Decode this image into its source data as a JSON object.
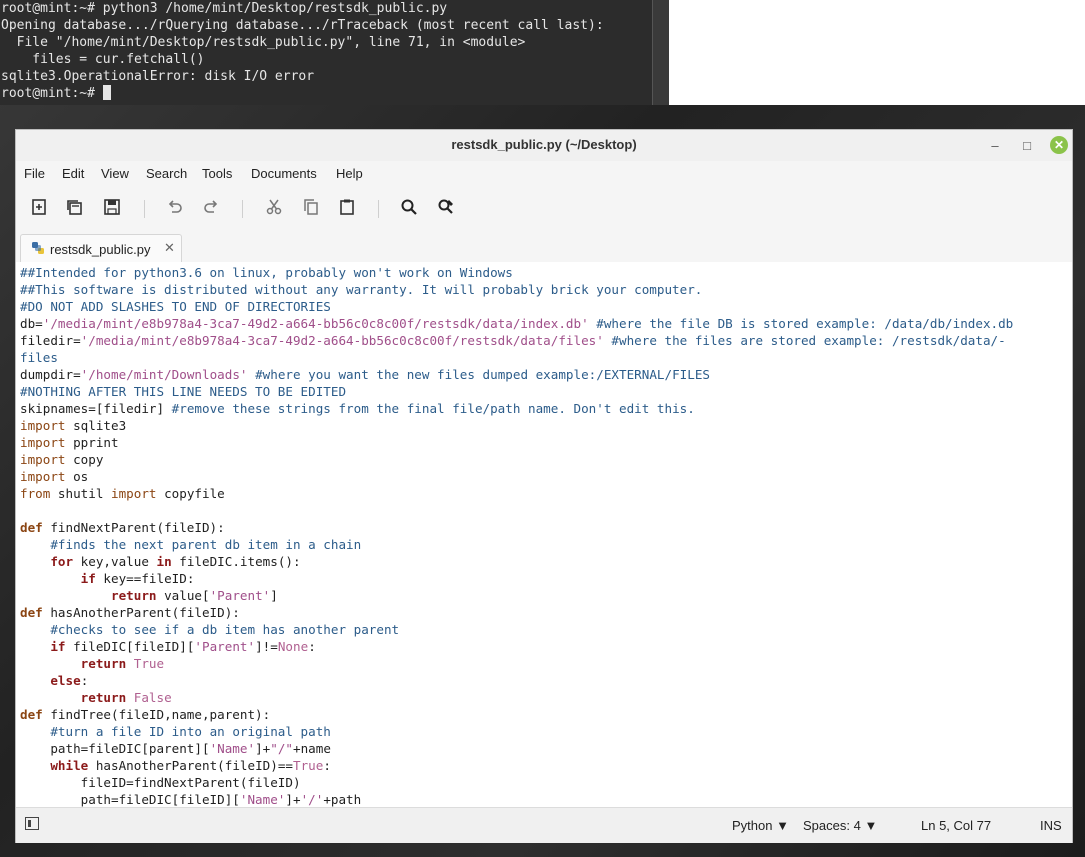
{
  "terminal": {
    "lines": [
      "root@mint:~# python3 /home/mint/Desktop/restsdk_public.py",
      "Opening database.../rQuerying database.../rTraceback (most recent call last):",
      "  File \"/home/mint/Desktop/restsdk_public.py\", line 71, in <module>",
      "    files = cur.fetchall()",
      "sqlite3.OperationalError: disk I/O error",
      "root@mint:~# "
    ]
  },
  "window": {
    "title": "restsdk_public.py (~/Desktop)",
    "controls": {
      "minimize": "–",
      "maximize": "□",
      "close": "✕"
    }
  },
  "menu": [
    "File",
    "Edit",
    "View",
    "Search",
    "Tools",
    "Documents",
    "Help"
  ],
  "toolbar": {
    "icons": [
      "new-file-icon",
      "open-icon",
      "save-icon",
      "undo-icon",
      "redo-icon",
      "cut-icon",
      "copy-icon",
      "paste-icon",
      "find-icon",
      "find-replace-icon"
    ]
  },
  "tab": {
    "label": "restsdk_public.py",
    "close": "✕"
  },
  "status": {
    "language": "Python",
    "spaces": "Spaces: 4",
    "position": "Ln 5, Col 77",
    "mode": "INS"
  },
  "colors": {
    "comment": "#2c5c8a",
    "string": "#a04f8a",
    "keyword": "#8b4513",
    "close_button": "#8bc34a"
  },
  "code": [
    [
      [
        "c-com",
        "##Intended for python3.6 on linux, probably won't work on Windows"
      ]
    ],
    [
      [
        "c-com",
        "##This software is distributed without any warranty. It will probably brick your computer."
      ]
    ],
    [
      [
        "c-com",
        "#DO NOT ADD SLASHES TO END OF DIRECTORIES"
      ]
    ],
    [
      [
        "",
        "db="
      ],
      [
        "c-str",
        "'/media/mint/e8b978a4-3ca7-49d2-a664-bb56c0c8c00f/restsdk/data/index.db'"
      ],
      [
        "c-com",
        " #where the file DB is stored example: /data/db/index.db"
      ]
    ],
    [
      [
        "",
        "filedir="
      ],
      [
        "c-str",
        "'/media/mint/e8b978a4-3ca7-49d2-a664-bb56c0c8c00f/restsdk/data/files'"
      ],
      [
        "c-com",
        " #where the files are stored example: /restsdk/data/-"
      ]
    ],
    [
      [
        "c-com",
        "files"
      ]
    ],
    [
      [
        "",
        "dumpdir="
      ],
      [
        "c-str",
        "'/home/mint/Downloads'"
      ],
      [
        "c-com",
        " #where you want the new files dumped example:/EXTERNAL/FILES"
      ]
    ],
    [
      [
        "c-com",
        "#NOTHING AFTER THIS LINE NEEDS TO BE EDITED"
      ]
    ],
    [
      [
        "",
        "skipnames=[filedir] "
      ],
      [
        "c-com",
        "#remove these strings from the final file/path name. Don't edit this."
      ]
    ],
    [
      [
        "c-kw",
        "import"
      ],
      [
        "",
        " sqlite3"
      ]
    ],
    [
      [
        "c-kw",
        "import"
      ],
      [
        "",
        " pprint"
      ]
    ],
    [
      [
        "c-kw",
        "import"
      ],
      [
        "",
        " copy"
      ]
    ],
    [
      [
        "c-kw",
        "import"
      ],
      [
        "",
        " os"
      ]
    ],
    [
      [
        "c-kw",
        "from"
      ],
      [
        "",
        " shutil "
      ],
      [
        "c-kw",
        "import"
      ],
      [
        "",
        " copyfile"
      ]
    ],
    [
      [
        "",
        ""
      ]
    ],
    [
      [
        "c-def",
        "def"
      ],
      [
        "",
        " findNextParent(fileID):"
      ]
    ],
    [
      [
        "",
        "    "
      ],
      [
        "c-com",
        "#finds the next parent db item in a chain"
      ]
    ],
    [
      [
        "",
        "    "
      ],
      [
        "c-bold",
        "for"
      ],
      [
        "",
        " key,value "
      ],
      [
        "c-bold",
        "in"
      ],
      [
        "",
        " fileDIC.items():"
      ]
    ],
    [
      [
        "",
        "        "
      ],
      [
        "c-bold",
        "if"
      ],
      [
        "",
        " key==fileID:"
      ]
    ],
    [
      [
        "",
        "            "
      ],
      [
        "c-bold",
        "return"
      ],
      [
        "",
        " value["
      ],
      [
        "c-str",
        "'Parent'"
      ],
      [
        "",
        "]"
      ]
    ],
    [
      [
        "c-def",
        "def"
      ],
      [
        "",
        " hasAnotherParent(fileID):"
      ]
    ],
    [
      [
        "",
        "    "
      ],
      [
        "c-com",
        "#checks to see if a db item has another parent"
      ]
    ],
    [
      [
        "",
        "    "
      ],
      [
        "c-bold",
        "if"
      ],
      [
        "",
        " fileDIC[fileID]["
      ],
      [
        "c-str",
        "'Parent'"
      ],
      [
        "",
        "]!="
      ],
      [
        "c-const",
        "None"
      ],
      [
        "",
        ":"
      ]
    ],
    [
      [
        "",
        "        "
      ],
      [
        "c-bold",
        "return"
      ],
      [
        "c-const",
        " True"
      ]
    ],
    [
      [
        "",
        "    "
      ],
      [
        "c-bold",
        "else"
      ],
      [
        "",
        ":"
      ]
    ],
    [
      [
        "",
        "        "
      ],
      [
        "c-bold",
        "return"
      ],
      [
        "c-const",
        " False"
      ]
    ],
    [
      [
        "c-def",
        "def"
      ],
      [
        "",
        " findTree(fileID,name,parent):"
      ]
    ],
    [
      [
        "",
        "    "
      ],
      [
        "c-com",
        "#turn a file ID into an original path"
      ]
    ],
    [
      [
        "",
        "    path=fileDIC[parent]["
      ],
      [
        "c-str",
        "'Name'"
      ],
      [
        "",
        "]+"
      ],
      [
        "c-str",
        "\"/\""
      ],
      [
        "",
        "+name"
      ]
    ],
    [
      [
        "",
        "    "
      ],
      [
        "c-bold",
        "while"
      ],
      [
        "",
        " hasAnotherParent(fileID)=="
      ],
      [
        "c-const",
        "True"
      ],
      [
        "",
        ":"
      ]
    ],
    [
      [
        "",
        "        fileID=findNextParent(fileID)"
      ]
    ],
    [
      [
        "",
        "        path=fileDIC[fileID]["
      ],
      [
        "c-str",
        "'Name'"
      ],
      [
        "",
        "]+"
      ],
      [
        "c-str",
        "'/'"
      ],
      [
        "",
        "+path"
      ]
    ]
  ]
}
